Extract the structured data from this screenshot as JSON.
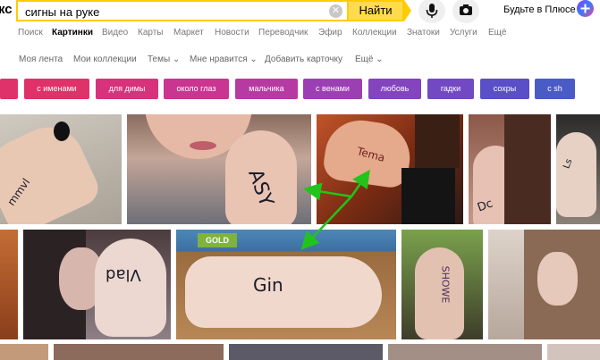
{
  "header": {
    "logo_fragment": "кс",
    "search_value": "сигны на руке",
    "find_label": "Найти",
    "plus_label": "Будьте в Плюсе"
  },
  "services": [
    {
      "label": "Поиск",
      "active": false
    },
    {
      "label": "Картинки",
      "active": true
    },
    {
      "label": "Видео",
      "active": false
    },
    {
      "label": "Карты",
      "active": false
    },
    {
      "label": "Маркет",
      "active": false
    },
    {
      "label": "Новости",
      "active": false
    },
    {
      "label": "Переводчик",
      "active": false
    },
    {
      "label": "Эфир",
      "active": false
    },
    {
      "label": "Коллекции",
      "active": false
    },
    {
      "label": "Знатоки",
      "active": false
    },
    {
      "label": "Услуги",
      "active": false
    },
    {
      "label": "Ещё",
      "active": false
    }
  ],
  "subnav": [
    {
      "label": "Моя лента"
    },
    {
      "label": "Мои коллекции"
    },
    {
      "label": "Темы ⌄"
    },
    {
      "label": "Мне нравится ⌄"
    },
    {
      "label": "Добавить карточку"
    },
    {
      "label": "Ещё ⌄"
    }
  ],
  "tags": [
    {
      "label": "",
      "color": "#e0326a"
    },
    {
      "label": "с именами",
      "color": "#e0326a"
    },
    {
      "label": "для димы",
      "color": "#d8327c"
    },
    {
      "label": "около глаз",
      "color": "#c93591"
    },
    {
      "label": "мальчика",
      "color": "#b73aa3"
    },
    {
      "label": "с венами",
      "color": "#9c3fb3"
    },
    {
      "label": "любовь",
      "color": "#8444bd"
    },
    {
      "label": "гадки",
      "color": "#7249c2"
    },
    {
      "label": "сохры",
      "color": "#5a4fc6"
    },
    {
      "label": "с sh",
      "color": "#4b5bc6"
    }
  ],
  "images": {
    "ink_1": "mmvl",
    "ink_2": "ASY",
    "ink_3": "Tema",
    "ink_4": "Dc",
    "ink_5": "Vlad",
    "ink_6": "Gin",
    "ink_7": "SHOWE",
    "ink_8": "Ls"
  },
  "colors": {
    "search_border": "#ffcc00",
    "find_button": "#ffdb4d",
    "arrow": "#22c41b"
  }
}
